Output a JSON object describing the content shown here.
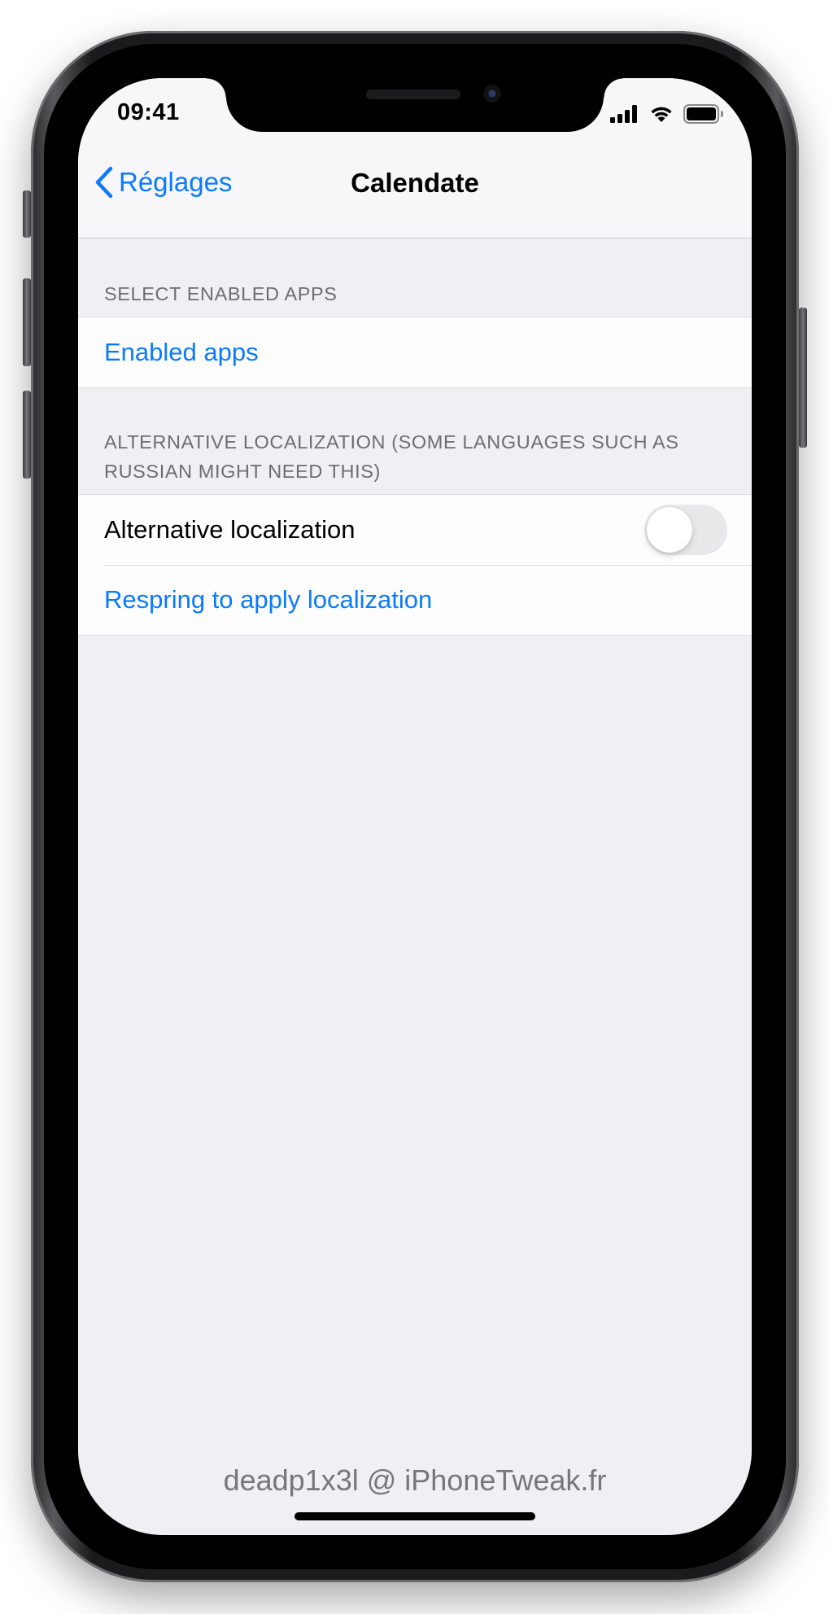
{
  "status_bar": {
    "time": "09:41",
    "icons": [
      "signal-icon",
      "wifi-icon",
      "battery-icon"
    ]
  },
  "nav": {
    "back_label": "Réglages",
    "title": "Calendate"
  },
  "sections": [
    {
      "header": "SELECT ENABLED APPS",
      "cells": [
        {
          "label": "Enabled apps",
          "type": "link"
        }
      ]
    },
    {
      "header": "ALTERNATIVE LOCALIZATION (SOME LANGUAGES SUCH AS RUSSIAN MIGHT NEED THIS)",
      "cells": [
        {
          "label": "Alternative localization",
          "type": "toggle",
          "on": false
        },
        {
          "label": "Respring to apply localization",
          "type": "link"
        }
      ]
    }
  ],
  "watermark": "deadp1x3l @ iPhoneTweak.fr",
  "colors": {
    "accent": "#0a7aff",
    "background": "#efeff4",
    "section_header": "#6d6d72",
    "toggle_off": "#e9e9eb"
  }
}
